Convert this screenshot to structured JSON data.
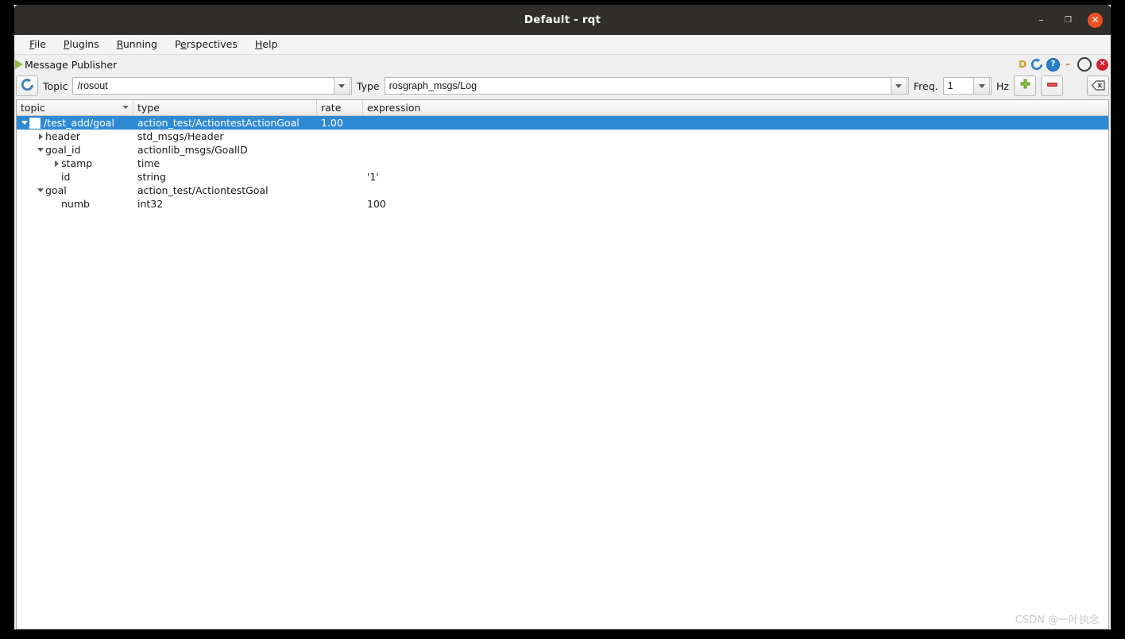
{
  "window": {
    "title": "Default - rqt",
    "controls": {
      "minimize": "–",
      "maximize": "❒",
      "close": "✕"
    }
  },
  "menubar": {
    "items": [
      {
        "name": "file",
        "pre": "",
        "mnemonic": "F",
        "post": "ile"
      },
      {
        "name": "plugins",
        "pre": "",
        "mnemonic": "P",
        "post": "lugins"
      },
      {
        "name": "running",
        "pre": "",
        "mnemonic": "R",
        "post": "unning"
      },
      {
        "name": "perspectives",
        "pre": "P",
        "mnemonic": "e",
        "post": "rspectives"
      },
      {
        "name": "help",
        "pre": "",
        "mnemonic": "H",
        "post": "elp"
      }
    ]
  },
  "plugin": {
    "title": "Message Publisher",
    "play_icon": "play-triangle-icon",
    "controls": {
      "dock_letter": "D",
      "reload_icon": "reload-icon",
      "help_icon": "help-question-icon",
      "minimize_glyph": "-",
      "float_glyph": "O",
      "close_glyph": "✕"
    }
  },
  "toolbar": {
    "refresh_icon": "refresh-icon",
    "topic_label": "Topic",
    "topic_value": "/rosout",
    "topic_placeholder": "/rosout",
    "type_label": "Type",
    "type_value": "rosgraph_msgs/Log",
    "type_placeholder": "rosgraph_msgs/Log",
    "freq_label": "Freq.",
    "freq_value": "1",
    "hz_label": "Hz",
    "add_icon": "plus-icon",
    "remove_icon": "minus-icon",
    "clear_icon": "clear-backspace-icon"
  },
  "tree": {
    "columns": [
      {
        "key": "topic",
        "label": "topic",
        "sorted": true
      },
      {
        "key": "type",
        "label": "type",
        "sorted": false
      },
      {
        "key": "rate",
        "label": "rate",
        "sorted": false
      },
      {
        "key": "expression",
        "label": "expression",
        "sorted": false
      }
    ],
    "rows": [
      {
        "name": "row-test-add-goal",
        "topic": "/test_add/goal",
        "type": "action_test/ActiontestActionGoal",
        "rate": "1.00",
        "expression": "",
        "depth": 0,
        "twisty": "open",
        "checkbox": "unchecked",
        "selected": true
      },
      {
        "name": "row-header",
        "topic": "header",
        "type": "std_msgs/Header",
        "rate": "",
        "expression": "",
        "depth": 1,
        "twisty": "closed",
        "checkbox": "none",
        "selected": false
      },
      {
        "name": "row-goal-id",
        "topic": "goal_id",
        "type": "actionlib_msgs/GoalID",
        "rate": "",
        "expression": "",
        "depth": 1,
        "twisty": "open",
        "checkbox": "none",
        "selected": false
      },
      {
        "name": "row-stamp",
        "topic": "stamp",
        "type": "time",
        "rate": "",
        "expression": "",
        "depth": 2,
        "twisty": "closed",
        "checkbox": "none",
        "selected": false
      },
      {
        "name": "row-id",
        "topic": "id",
        "type": "string",
        "rate": "",
        "expression": "'1'",
        "depth": 2,
        "twisty": "none",
        "checkbox": "none",
        "selected": false
      },
      {
        "name": "row-goal",
        "topic": "goal",
        "type": "action_test/ActiontestGoal",
        "rate": "",
        "expression": "",
        "depth": 1,
        "twisty": "open",
        "checkbox": "none",
        "selected": false
      },
      {
        "name": "row-numb",
        "topic": "numb",
        "type": "int32",
        "rate": "",
        "expression": "100",
        "depth": 2,
        "twisty": "none",
        "checkbox": "none",
        "selected": false
      }
    ]
  },
  "watermark": "CSDN @一叶执念",
  "colors": {
    "titlebar": "#2f2e2b",
    "close_button": "#ef5023",
    "selection": "#2f8ad4",
    "window_bg": "#efefef",
    "accent_green": "#8fbc3f",
    "accent_red": "#cf2030",
    "accent_blue": "#2a7fc9",
    "accent_gold": "#cf9a1c"
  }
}
